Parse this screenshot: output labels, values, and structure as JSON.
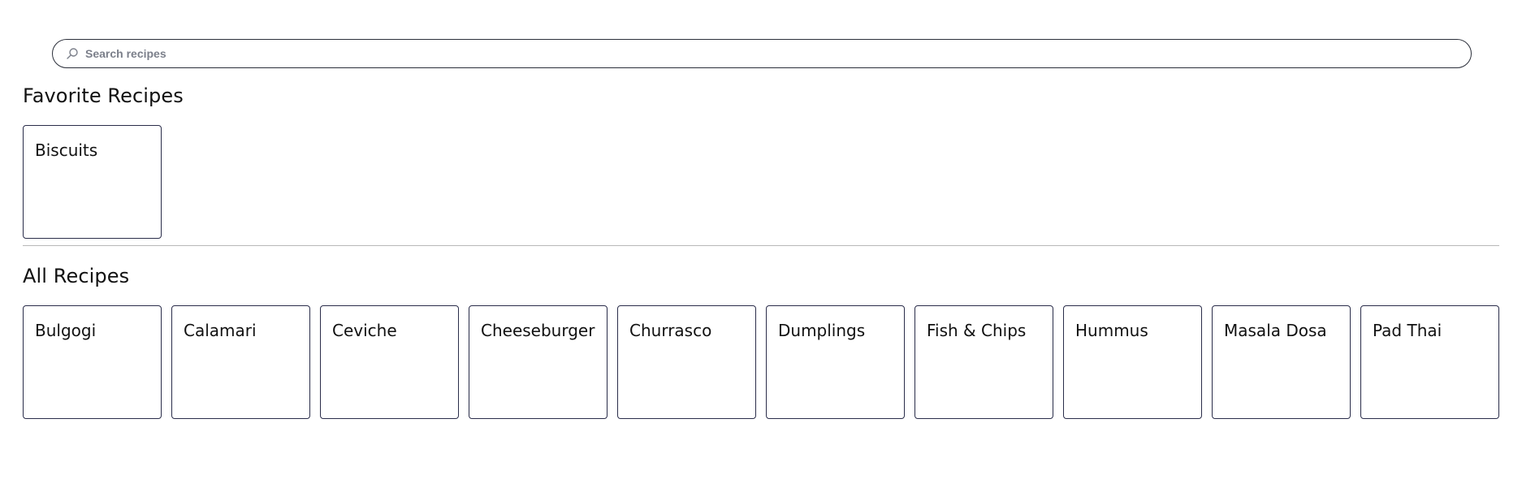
{
  "search": {
    "placeholder": "Search recipes",
    "value": "",
    "icon": "search-icon"
  },
  "favorites": {
    "heading": "Favorite Recipes",
    "recipes": [
      {
        "name": "Biscuits"
      }
    ]
  },
  "all": {
    "heading": "All Recipes",
    "recipes": [
      {
        "name": "Bulgogi"
      },
      {
        "name": "Calamari"
      },
      {
        "name": "Ceviche"
      },
      {
        "name": "Cheeseburger"
      },
      {
        "name": "Churrasco"
      },
      {
        "name": "Dumplings"
      },
      {
        "name": "Fish & Chips"
      },
      {
        "name": "Hummus"
      },
      {
        "name": "Masala Dosa"
      },
      {
        "name": "Pad Thai"
      }
    ]
  },
  "colors": {
    "card_border": "#2a2d4a",
    "divider": "#b8b8b8",
    "search_border": "#2b2f3a"
  }
}
